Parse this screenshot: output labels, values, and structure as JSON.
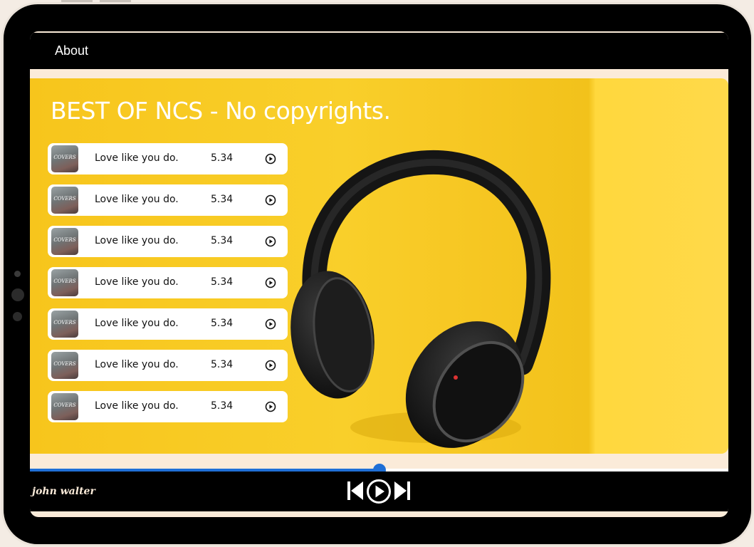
{
  "nav": {
    "about_label": "About"
  },
  "hero": {
    "title": "BEST OF NCS - No copyrights."
  },
  "songs": [
    {
      "title": "Love like you do.",
      "duration": "5.34",
      "cover_text": "COVERS"
    },
    {
      "title": "Love like you do.",
      "duration": "5.34",
      "cover_text": "COVERS"
    },
    {
      "title": "Love like you do.",
      "duration": "5.34",
      "cover_text": "COVERS"
    },
    {
      "title": "Love like you do.",
      "duration": "5.34",
      "cover_text": "COVERS"
    },
    {
      "title": "Love like you do.",
      "duration": "5.34",
      "cover_text": "COVERS"
    },
    {
      "title": "Love like you do.",
      "duration": "5.34",
      "cover_text": "COVERS"
    },
    {
      "title": "Love like you do.",
      "duration": "5.34",
      "cover_text": "COVERS"
    }
  ],
  "player": {
    "artist": "john walter",
    "progress_fraction": 0.5,
    "icons": [
      "skip-back-icon",
      "play-circle-icon",
      "skip-forward-icon"
    ]
  },
  "colors": {
    "accent": "#1f6fd6",
    "hero_bg": "#f7c51c",
    "bezel": "#000000",
    "screen_bg": "#fbebd9"
  }
}
